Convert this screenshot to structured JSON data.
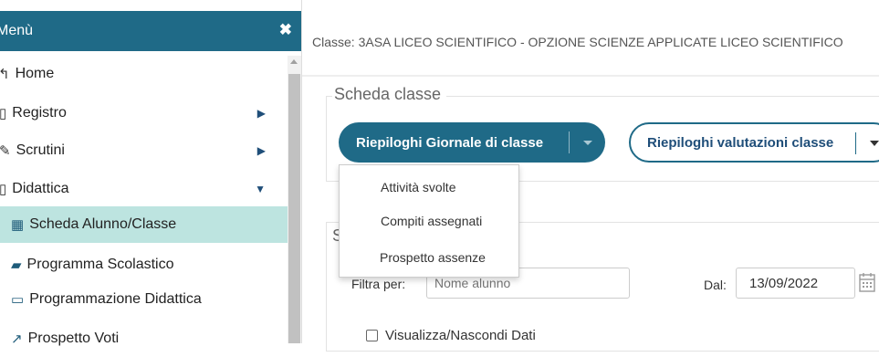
{
  "sidebar": {
    "title": "Menù",
    "close_icon": "✖",
    "items": [
      {
        "label": "Home",
        "icon": "↰",
        "icon_name": "home-icon"
      },
      {
        "label": "Registro",
        "icon": "▯",
        "icon_name": "register-icon",
        "arrow": "▶"
      },
      {
        "label": "Scrutini",
        "icon": "✎",
        "icon_name": "scrutini-icon",
        "arrow": "▶"
      },
      {
        "label": "Didattica",
        "icon": "▯",
        "icon_name": "book-icon",
        "arrow": "▼"
      },
      {
        "label": "Scheda Alunno/Classe",
        "icon": "▦",
        "icon_name": "table-icon",
        "active": true
      },
      {
        "label": "Programma Scolastico",
        "icon": "▰",
        "icon_name": "book-icon"
      },
      {
        "label": "Programmazione Didattica",
        "icon": "▭",
        "icon_name": "keyboard-icon"
      },
      {
        "label": "Prospetto Voti",
        "icon": "↗",
        "icon_name": "chart-line-icon"
      }
    ]
  },
  "main": {
    "breadcrumb": "Classe: 3ASA LICEO SCIENTIFICO - OPZIONE SCIENZE APPLICATE LICEO SCIENTIFICO",
    "scheda_legend": "Scheda classe",
    "second_legend": "S",
    "btn_giornale": "Riepiloghi Giornale di classe",
    "btn_valutazioni": "Riepiloghi valutazioni classe",
    "dropdown": [
      "Attività svolte",
      "Compiti assegnati",
      "Prospetto assenze"
    ],
    "filter_label": "Filtra per:",
    "filter_placeholder": "Nome alunno",
    "dal_label": "Dal:",
    "date_value": "13/09/2022",
    "checkbox_label": "Visualizza/Nascondi Dati"
  },
  "colors": {
    "primary": "#1f6a87",
    "active_item": "#bde4e0"
  }
}
